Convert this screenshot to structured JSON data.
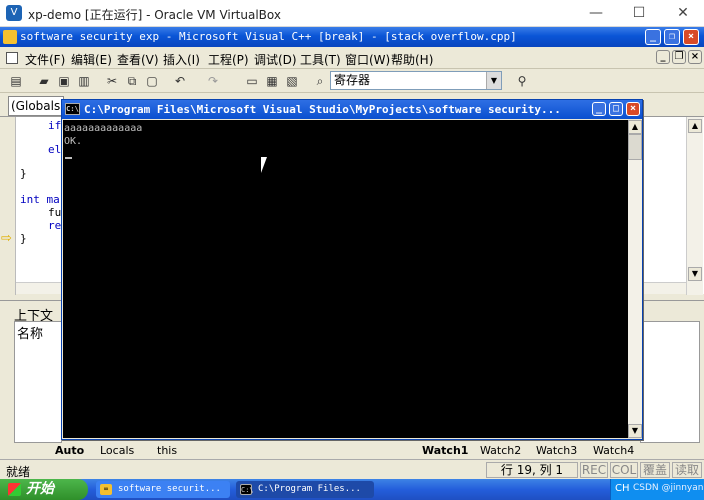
{
  "host_window": {
    "title": "xp-demo [正在运行] - Oracle VM VirtualBox",
    "minimize": "—",
    "maximize": "☐",
    "close": "✕"
  },
  "vc_window": {
    "title": "software security exp - Microsoft Visual C++ [break] - [stack overflow.cpp]"
  },
  "menu": {
    "items": [
      "文件(F)",
      "编辑(E)",
      "查看(V)",
      "插入(I)",
      "工程(P)",
      "调试(D)",
      "工具(T)",
      "窗口(W)",
      "帮助(H)"
    ]
  },
  "toolbar": {
    "combo_value": "寄存器"
  },
  "editor": {
    "scope": "(Globals",
    "lines": [
      "if",
      "el",
      "}",
      "int ma",
      "fu",
      "re",
      "}"
    ]
  },
  "console": {
    "title": "C:\\Program Files\\Microsoft Visual Studio\\MyProjects\\software security...",
    "output": [
      "aaaaaaaaaaaaa",
      "OK."
    ]
  },
  "lower": {
    "context_label": "上下文",
    "name_header": "名称"
  },
  "tabs_left": [
    "Auto",
    "Locals",
    "this"
  ],
  "tabs_right": [
    "Watch1",
    "Watch2",
    "Watch3",
    "Watch4"
  ],
  "status": {
    "ready": "就绪",
    "position": "行 19, 列 1",
    "rec": "REC",
    "col": "COL",
    "ovr": "覆盖",
    "read": "读取"
  },
  "taskbar": {
    "start": "开始",
    "tasks": [
      {
        "label": "software securit..."
      },
      {
        "label": "C:\\Program Files..."
      }
    ],
    "tray_lang": "CH",
    "tray_watermark": "CSDN @jinnyan"
  }
}
